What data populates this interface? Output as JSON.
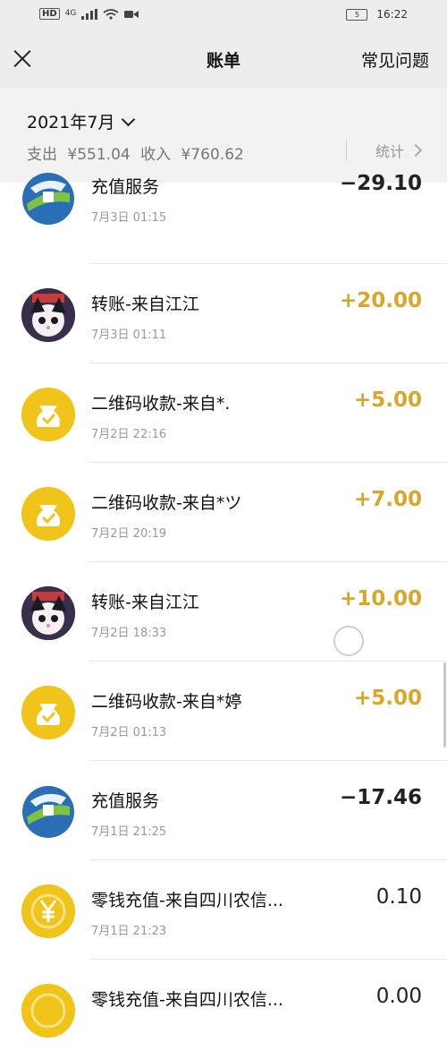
{
  "status_bar": {
    "hd": "HD",
    "network": "4G",
    "battery": "5",
    "time": "16:22"
  },
  "header": {
    "title": "账单",
    "help_label": "常见问题"
  },
  "summary": {
    "month": "2021年7月",
    "expense_label": "支出",
    "expense": "¥551.04",
    "income_label": "收入",
    "income": "¥760.62",
    "stats_label": "统计"
  },
  "transactions": [
    {
      "name": "充值服务",
      "time": "7月3日 01:15",
      "amount": "−29.10",
      "type": "expense",
      "icon": "recharge-service-icon"
    },
    {
      "name": "转账-来自江江",
      "time": "7月3日 01:11",
      "amount": "+20.00",
      "type": "income",
      "icon": "user-avatar"
    },
    {
      "name": "二维码收款-来自*.",
      "time": "7月2日 22:16",
      "amount": "+5.00",
      "type": "income",
      "icon": "qr-payment-icon"
    },
    {
      "name": "二维码收款-来自*ツ",
      "time": "7月2日 20:19",
      "amount": "+7.00",
      "type": "income",
      "icon": "qr-payment-icon"
    },
    {
      "name": "转账-来自江江",
      "time": "7月2日 18:33",
      "amount": "+10.00",
      "type": "income",
      "icon": "user-avatar"
    },
    {
      "name": "二维码收款-来自*婷",
      "time": "7月2日 01:13",
      "amount": "+5.00",
      "type": "income",
      "icon": "qr-payment-icon"
    },
    {
      "name": "充值服务",
      "time": "7月1日 21:25",
      "amount": "−17.46",
      "type": "expense",
      "icon": "recharge-service-icon"
    },
    {
      "name": "零钱充值-来自四川农信...",
      "time": "7月1日 21:23",
      "amount": "0.10",
      "type": "neutral",
      "icon": "yen-coin-icon"
    },
    {
      "name": "零钱充值-来自四川农信...",
      "time": "",
      "amount": "0.00",
      "type": "neutral",
      "icon": "yen-coin-icon"
    }
  ],
  "colors": {
    "income": "#d8a72a",
    "expense": "#222222",
    "accent": "#f0c419"
  }
}
